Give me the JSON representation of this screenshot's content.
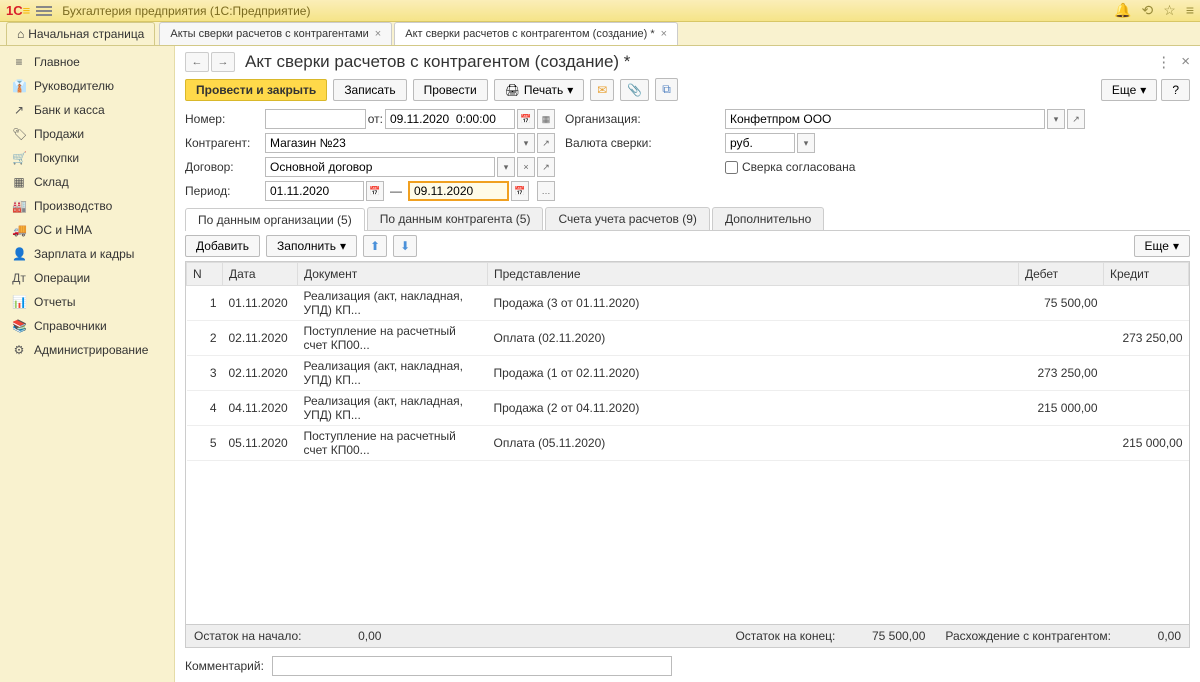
{
  "app": {
    "title": "Бухгалтерия предприятия (1С:Предприятие)"
  },
  "tabs": {
    "home": "Начальная страница",
    "list": [
      {
        "label": "Акты сверки расчетов с контрагентами",
        "active": false
      },
      {
        "label": "Акт сверки расчетов с контрагентом (создание) *",
        "active": true
      }
    ]
  },
  "sidebar": {
    "items": [
      {
        "icon": "≡",
        "label": "Главное"
      },
      {
        "icon": "👔",
        "label": "Руководителю"
      },
      {
        "icon": "↗",
        "label": "Банк и касса"
      },
      {
        "icon": "🏷",
        "label": "Продажи"
      },
      {
        "icon": "🛒",
        "label": "Покупки"
      },
      {
        "icon": "▦",
        "label": "Склад"
      },
      {
        "icon": "🏭",
        "label": "Производство"
      },
      {
        "icon": "🚚",
        "label": "ОС и НМА"
      },
      {
        "icon": "👤",
        "label": "Зарплата и кадры"
      },
      {
        "icon": "Дт",
        "label": "Операции"
      },
      {
        "icon": "📊",
        "label": "Отчеты"
      },
      {
        "icon": "📚",
        "label": "Справочники"
      },
      {
        "icon": "⚙",
        "label": "Администрирование"
      }
    ]
  },
  "page": {
    "title": "Акт сверки расчетов с контрагентом (создание) *"
  },
  "toolbar": {
    "post_close": "Провести и закрыть",
    "write": "Записать",
    "post": "Провести",
    "print": "Печать",
    "more": "Еще",
    "help": "?"
  },
  "form": {
    "number_label": "Номер:",
    "number": "",
    "from_label": "от:",
    "from_value": "09.11.2020  0:00:00",
    "org_label": "Организация:",
    "org_value": "Конфетпром ООО",
    "contragent_label": "Контрагент:",
    "contragent_value": "Магазин №23",
    "currency_label": "Валюта сверки:",
    "currency_value": "руб.",
    "contract_label": "Договор:",
    "contract_value": "Основной договор",
    "agreed_label": "Сверка согласована",
    "period_label": "Период:",
    "period_from": "01.11.2020",
    "period_to": "09.11.2020",
    "dash": "—"
  },
  "subtabs": [
    "По данным организации (5)",
    "По данным контрагента (5)",
    "Счета учета расчетов (9)",
    "Дополнительно"
  ],
  "subtoolbar": {
    "add": "Добавить",
    "fill": "Заполнить",
    "more": "Еще"
  },
  "table": {
    "headers": {
      "n": "N",
      "date": "Дата",
      "doc": "Документ",
      "repr": "Представление",
      "debit": "Дебет",
      "credit": "Кредит"
    },
    "rows": [
      {
        "n": "1",
        "date": "01.11.2020",
        "doc": "Реализация (акт, накладная, УПД) КП...",
        "repr": "Продажа (3 от 01.11.2020)",
        "debit": "75 500,00",
        "credit": ""
      },
      {
        "n": "2",
        "date": "02.11.2020",
        "doc": "Поступление на расчетный счет КП00...",
        "repr": "Оплата (02.11.2020)",
        "debit": "",
        "credit": "273 250,00"
      },
      {
        "n": "3",
        "date": "02.11.2020",
        "doc": "Реализация (акт, накладная, УПД) КП...",
        "repr": "Продажа (1 от 02.11.2020)",
        "debit": "273 250,00",
        "credit": ""
      },
      {
        "n": "4",
        "date": "04.11.2020",
        "doc": "Реализация (акт, накладная, УПД) КП...",
        "repr": "Продажа (2 от 04.11.2020)",
        "debit": "215 000,00",
        "credit": ""
      },
      {
        "n": "5",
        "date": "05.11.2020",
        "doc": "Поступление на расчетный счет КП00...",
        "repr": "Оплата (05.11.2020)",
        "debit": "",
        "credit": "215 000,00"
      }
    ]
  },
  "summary": {
    "start_label": "Остаток на начало:",
    "start_value": "0,00",
    "end_label": "Остаток на конец:",
    "end_value": "75 500,00",
    "diff_label": "Расхождение с контрагентом:",
    "diff_value": "0,00"
  },
  "comment": {
    "label": "Комментарий:",
    "value": ""
  }
}
